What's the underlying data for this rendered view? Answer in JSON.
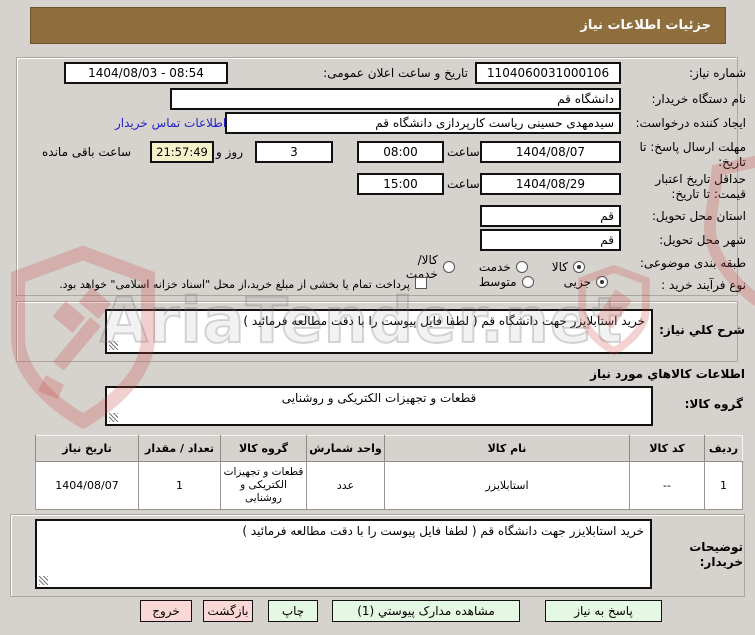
{
  "title": "جزئیات اطلاعات نیاز",
  "watermark": "AriaTender.net",
  "form": {
    "need_no_label": "شماره نیاز:",
    "need_no": "1104060031000106",
    "announce_label": "تاریخ و ساعت اعلان عمومی:",
    "announce_value": "1404/08/03 - 08:54",
    "buyer_org_label": "نام دستگاه خریدار:",
    "buyer_org": "دانشگاه قم",
    "creator_label": "ایجاد کننده درخواست:",
    "creator": "سیدمهدی حسینی ریاست کارپردازی دانشگاه قم",
    "contact_link": "اطلاعات تماس خریدار",
    "deadline_label": "مهلت ارسال پاسخ: تا تاریخ:",
    "deadline_date": "1404/08/07",
    "hour_label": "ساعت",
    "deadline_time": "08:00",
    "days_left": "3",
    "days_and_label": "روز و",
    "time_left": "21:57:49",
    "remaining_label": "ساعت باقی مانده",
    "validity_label": "حداقل تاریخ اعتبار قیمت: تا تاریخ:",
    "validity_date": "1404/08/29",
    "validity_time": "15:00",
    "province_label": "استان محل تحویل:",
    "province": "قم",
    "city_label": "شهر محل تحویل:",
    "city": "قم",
    "category_label": "طبقه بندی موضوعی:",
    "category_options": [
      "کالا",
      "خدمت",
      "کالا/خدمت"
    ],
    "category_selected": "کالا",
    "process_label": "نوع فرآیند خرید :",
    "process_options": [
      "جزیی",
      "متوسط"
    ],
    "process_selected": "جزیی",
    "treasury_note": "پرداخت تمام یا بخشی از مبلغ خرید،از محل \"اسناد خزانه اسلامی\" خواهد بود."
  },
  "general": {
    "label": "شرح کلي نیاز:",
    "value": "خرید استابلایزر جهت دانشگاه قم ( لطفا فایل پیوست را با دقت مطالعه فرمائید )"
  },
  "goods": {
    "section_header": "اطلاعات کالاهاي مورد نياز",
    "group_label": "گروه کالا:",
    "group_value": "قطعات و تجهیزات الکتریکی و روشنایی"
  },
  "table": {
    "headers": [
      "ردیف",
      "کد کالا",
      "نام کالا",
      "واحد شمارش",
      "گروه کالا",
      "تعداد / مقدار",
      "تاریخ نیاز"
    ],
    "rows": [
      [
        "1",
        "--",
        "استابلایزر",
        "عدد",
        "قطعات و تجهیزات الکتریکی و روشنایی",
        "1",
        "1404/08/07"
      ]
    ]
  },
  "notes": {
    "label": "توضیحات خریدار:",
    "value": "خرید استابلایزر جهت دانشگاه قم ( لطفا فایل پیوست را با دقت مطالعه فرمائید )"
  },
  "buttons": [
    {
      "label": "پاسخ به نیاز",
      "type": "green"
    },
    {
      "label": "مشاهده مدارک پیوستي (1)",
      "type": "green"
    },
    {
      "label": "چاپ",
      "type": "green"
    },
    {
      "label": "بازگشت",
      "type": "pink"
    },
    {
      "label": "خروج",
      "type": "pink"
    }
  ],
  "colors": {
    "header_brown": "#8f6e3e",
    "button_green": "#e4f8e4",
    "button_pink": "#fbd8d8",
    "highlight_yellow": "#f5f1cb",
    "link_blue": "#2323cc",
    "watermark_red": "#cc4444"
  }
}
